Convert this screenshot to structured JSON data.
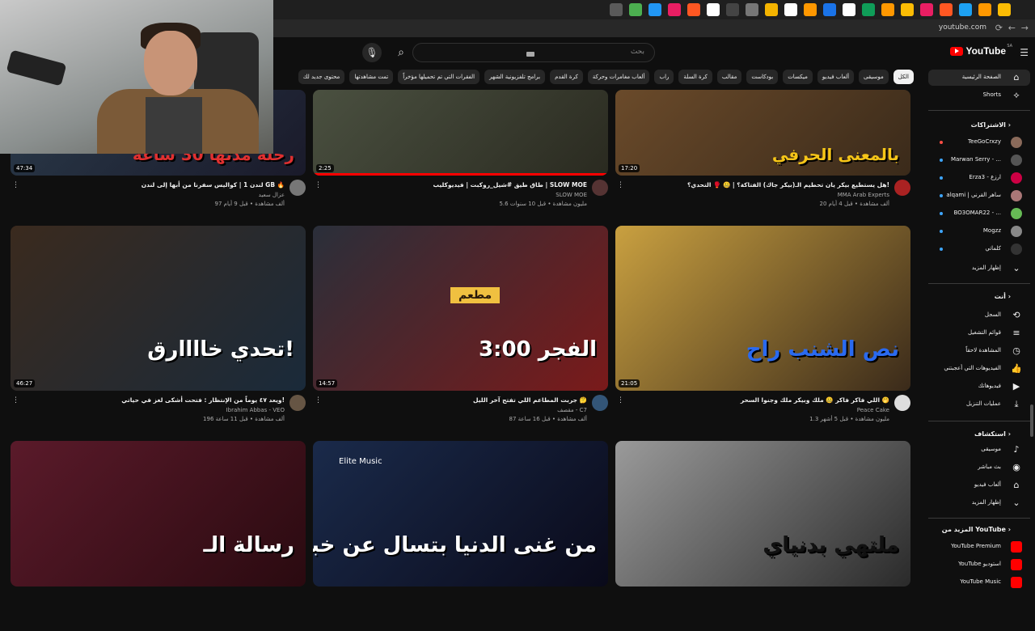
{
  "browser": {
    "url": "youtube.com",
    "tab_colors": [
      "#5a5a5a",
      "#4caf50",
      "#2196f3",
      "#e91e63",
      "#ff5722",
      "#ffffff",
      "#444",
      "#777",
      "#f4b400",
      "#fff",
      "#ff9800",
      "#1a73e8",
      "#fff",
      "#0f9d58",
      "#ff9800",
      "#fbbc04",
      "#e91e63",
      "#ff5722",
      "#1da1f2",
      "#ff9800",
      "#fbbc04"
    ]
  },
  "header": {
    "search_placeholder": "بحث",
    "logo_text": "YouTube",
    "logo_region": "SA"
  },
  "chips": [
    {
      "label": "الكل",
      "active": false
    },
    {
      "label": "الكل",
      "active": true
    },
    {
      "label": "موسيقى",
      "active": false
    },
    {
      "label": "ألعاب فيديو",
      "active": false
    },
    {
      "label": "ميكسات",
      "active": false
    },
    {
      "label": "بودكاست",
      "active": false
    },
    {
      "label": "مقالب",
      "active": false
    },
    {
      "label": "كرة السلة",
      "active": false
    },
    {
      "label": "راب",
      "active": false
    },
    {
      "label": "ألعاب مغامرات وحركة",
      "active": false
    },
    {
      "label": "كرة القدم",
      "active": false
    },
    {
      "label": "برامج تلفزيونية الشهر",
      "active": false
    },
    {
      "label": "الفقرات التي تم تحميلها مؤخراً",
      "active": false
    },
    {
      "label": "تمت مشاهدتها",
      "active": false
    },
    {
      "label": "محتوى جديد لك",
      "active": false
    }
  ],
  "sidebar": {
    "home": "الصفحة الرئيسية",
    "shorts": "Shorts",
    "subs_title": "الاشتراكات",
    "subs": [
      {
        "name": "TeeGoCrxzy",
        "color": "#8a6a5a",
        "live": true
      },
      {
        "name": "Marwan Serry - ...",
        "color": "#555",
        "live": false
      },
      {
        "name": "Erza3 - ارزع",
        "color": "#c04",
        "live": false
      },
      {
        "name": "alqami | ساهر القرني",
        "color": "#a77",
        "live": false
      },
      {
        "name": "BO3OMAR22 - ...",
        "color": "#6b5",
        "live": false
      },
      {
        "name": "Mogzz",
        "color": "#888",
        "live": false
      },
      {
        "name": "كلماتي",
        "color": "#333",
        "live": false
      }
    ],
    "show_more": "إظهار المزيد",
    "you_title": "أنت",
    "you_items": [
      {
        "label": "السجل",
        "icon": "history-icon",
        "glyph": "⟲"
      },
      {
        "label": "قوائم التشغيل",
        "icon": "playlist-icon",
        "glyph": "≡"
      },
      {
        "label": "المشاهدة لاحقاً",
        "icon": "clock-icon",
        "glyph": "◷"
      },
      {
        "label": "الفيديوهات التي أعجبتني",
        "icon": "like-icon",
        "glyph": "👍"
      },
      {
        "label": "فيديوهاتك",
        "icon": "video-icon",
        "glyph": "▶"
      },
      {
        "label": "عمليات التنزيل",
        "icon": "download-icon",
        "glyph": "⤓"
      }
    ],
    "explore_title": "استكشاف",
    "explore_items": [
      {
        "label": "موسيقى",
        "icon": "music-icon",
        "glyph": "♪"
      },
      {
        "label": "بث مباشر",
        "icon": "live-icon",
        "glyph": "◉"
      },
      {
        "label": "ألعاب فيديو",
        "icon": "gaming-icon",
        "glyph": "⌂"
      },
      {
        "label": "إظهار المزيد",
        "icon": "chevron-down-icon",
        "glyph": "⌄"
      }
    ],
    "more_title": "المزيد من YouTube",
    "more_items": [
      {
        "label": "YouTube Premium",
        "color": "#ff0000"
      },
      {
        "label": "YouTube استوديو",
        "color": "#ff0000"
      },
      {
        "label": "YouTube Music",
        "color": "#ff0000"
      }
    ]
  },
  "videos": [
    {
      "title": "هل يستطيع بيكر يان تحطيم الـ(بيكر جاك) الفتاكة؟ | 🤐 🥊 التحدي؟!",
      "channel": "MMA Arab Experts",
      "meta": "20 ألف مشاهدة • قبل 4 أيام",
      "duration": "17:20",
      "thumb_text": "بالمعنى الحرفي",
      "bg": "#6a4a2a",
      "bg2": "#3a2a1a",
      "text_color": "#f5c518",
      "avatar": "#aa2222"
    },
    {
      "title": "طاق طيق #شيل_روكبت | فيديوكليب | SLOW MOE",
      "channel": "SLOW MOE",
      "meta": "5.6 مليون مشاهدة • قبل 10 سنوات",
      "duration": "2:25",
      "thumb_text": "",
      "bg": "#4a5040",
      "bg2": "#2a2a20",
      "text_color": "#ffffff",
      "avatar": "#553333",
      "progress": 100
    },
    {
      "title": "لندن 1 | كواليس سفرنا من أبها إلى لندن GB 🔥",
      "channel": "عزال سعيد",
      "meta": "97 ألف مشاهدة • قبل 9 أيام",
      "duration": "47:34",
      "thumb_text": "رحلة مدتها 30 ساعة",
      "bg": "#2a3a4a",
      "bg2": "#1a1a2a",
      "text_color": "#e03030",
      "avatar": "#777777"
    },
    {
      "title": "اللي فاكر فاكر 🤐 ملك وبيكر ملك وجنوا السحر 🤭",
      "channel": "Peace Cake",
      "meta": "1.3 مليون مشاهدة • قبل 5 أشهر",
      "duration": "21:05",
      "thumb_text": "نص الشنب راح",
      "bg": "#c9a040",
      "bg2": "#3a2a1a",
      "text_color": "#2a6af0",
      "avatar": "#dddddd"
    },
    {
      "title": "جربت المطاعم اللي تفتح آخر الليل 🤔",
      "channel": "مقصف - C7",
      "meta": "87 ألف مشاهدة • قبل 16 ساعة",
      "duration": "14:57",
      "thumb_text": "3:00 الفجر",
      "sub_text": "مطعم",
      "bg": "#2a2f3a",
      "bg2": "#7a1a1a",
      "text_color": "#ffffff",
      "avatar": "#335577"
    },
    {
      "title": "ويعد ٤٧ يوماً من الإنتظار : فتحت أشكى لغز في حياتي!",
      "channel": "Ibrahim Abbas - VEO",
      "meta": "196 ألف مشاهدة • قبل 11 ساعة",
      "duration": "46:27",
      "thumb_text": "تحدي خاااارق!",
      "bg": "#3a2a1e",
      "bg2": "#1a2a3a",
      "text_color": "#ffffff",
      "avatar": "#665544"
    },
    {
      "title": "",
      "channel": "",
      "meta": "",
      "duration": "",
      "thumb_text": "ملتهي بدنياي",
      "bg": "#9a9a9a",
      "bg2": "#2a2a2a",
      "text_color": "#111111",
      "avatar": "#000000"
    },
    {
      "title": "",
      "channel": "",
      "meta": "",
      "duration": "",
      "thumb_text": "من غنى الدنيا بتسال عن خبر؟",
      "brand": "Elite Music",
      "bg": "#1a2a4a",
      "bg2": "#0a0a1a",
      "text_color": "#ffffff",
      "avatar": "#000000"
    },
    {
      "title": "",
      "channel": "",
      "meta": "",
      "duration": "",
      "thumb_text": "رسالة الـ",
      "bg": "#5a1a2a",
      "bg2": "#2a0a10",
      "text_color": "#ffffff",
      "avatar": "#000000"
    }
  ]
}
